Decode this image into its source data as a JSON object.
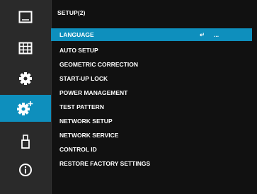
{
  "sidebar": {
    "items": [
      {
        "icon": "picture-icon"
      },
      {
        "icon": "grid-icon"
      },
      {
        "icon": "gear-icon"
      },
      {
        "icon": "gear-plus-icon",
        "active": true
      },
      {
        "icon": "usb-icon"
      },
      {
        "icon": "info-icon"
      }
    ]
  },
  "menu": {
    "title": "SETUP(2)",
    "items": [
      {
        "label": "LANGUAGE",
        "value": "↵",
        "more": "..."
      },
      {
        "label": "AUTO SETUP"
      },
      {
        "label": "GEOMETRIC CORRECTION"
      },
      {
        "label": "START-UP LOCK"
      },
      {
        "label": "POWER MANAGEMENT"
      },
      {
        "label": "TEST PATTERN"
      },
      {
        "label": "NETWORK SETUP"
      },
      {
        "label": "NETWORK SERVICE"
      },
      {
        "label": "CONTROL ID"
      },
      {
        "label": "RESTORE FACTORY SETTINGS"
      }
    ]
  },
  "colors": {
    "accent": "#0e8fbd",
    "background": "#111111",
    "sidebar": "#2a2a2a",
    "text": "#ffffff"
  }
}
